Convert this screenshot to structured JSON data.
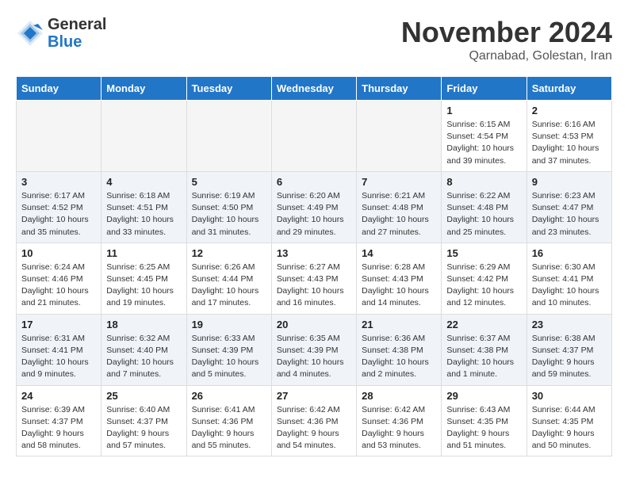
{
  "logo": {
    "general": "General",
    "blue": "Blue"
  },
  "title": "November 2024",
  "subtitle": "Qarnabad, Golestan, Iran",
  "weekdays": [
    "Sunday",
    "Monday",
    "Tuesday",
    "Wednesday",
    "Thursday",
    "Friday",
    "Saturday"
  ],
  "weeks": [
    [
      {
        "day": "",
        "info": ""
      },
      {
        "day": "",
        "info": ""
      },
      {
        "day": "",
        "info": ""
      },
      {
        "day": "",
        "info": ""
      },
      {
        "day": "",
        "info": ""
      },
      {
        "day": "1",
        "info": "Sunrise: 6:15 AM\nSunset: 4:54 PM\nDaylight: 10 hours\nand 39 minutes."
      },
      {
        "day": "2",
        "info": "Sunrise: 6:16 AM\nSunset: 4:53 PM\nDaylight: 10 hours\nand 37 minutes."
      }
    ],
    [
      {
        "day": "3",
        "info": "Sunrise: 6:17 AM\nSunset: 4:52 PM\nDaylight: 10 hours\nand 35 minutes."
      },
      {
        "day": "4",
        "info": "Sunrise: 6:18 AM\nSunset: 4:51 PM\nDaylight: 10 hours\nand 33 minutes."
      },
      {
        "day": "5",
        "info": "Sunrise: 6:19 AM\nSunset: 4:50 PM\nDaylight: 10 hours\nand 31 minutes."
      },
      {
        "day": "6",
        "info": "Sunrise: 6:20 AM\nSunset: 4:49 PM\nDaylight: 10 hours\nand 29 minutes."
      },
      {
        "day": "7",
        "info": "Sunrise: 6:21 AM\nSunset: 4:48 PM\nDaylight: 10 hours\nand 27 minutes."
      },
      {
        "day": "8",
        "info": "Sunrise: 6:22 AM\nSunset: 4:48 PM\nDaylight: 10 hours\nand 25 minutes."
      },
      {
        "day": "9",
        "info": "Sunrise: 6:23 AM\nSunset: 4:47 PM\nDaylight: 10 hours\nand 23 minutes."
      }
    ],
    [
      {
        "day": "10",
        "info": "Sunrise: 6:24 AM\nSunset: 4:46 PM\nDaylight: 10 hours\nand 21 minutes."
      },
      {
        "day": "11",
        "info": "Sunrise: 6:25 AM\nSunset: 4:45 PM\nDaylight: 10 hours\nand 19 minutes."
      },
      {
        "day": "12",
        "info": "Sunrise: 6:26 AM\nSunset: 4:44 PM\nDaylight: 10 hours\nand 17 minutes."
      },
      {
        "day": "13",
        "info": "Sunrise: 6:27 AM\nSunset: 4:43 PM\nDaylight: 10 hours\nand 16 minutes."
      },
      {
        "day": "14",
        "info": "Sunrise: 6:28 AM\nSunset: 4:43 PM\nDaylight: 10 hours\nand 14 minutes."
      },
      {
        "day": "15",
        "info": "Sunrise: 6:29 AM\nSunset: 4:42 PM\nDaylight: 10 hours\nand 12 minutes."
      },
      {
        "day": "16",
        "info": "Sunrise: 6:30 AM\nSunset: 4:41 PM\nDaylight: 10 hours\nand 10 minutes."
      }
    ],
    [
      {
        "day": "17",
        "info": "Sunrise: 6:31 AM\nSunset: 4:41 PM\nDaylight: 10 hours\nand 9 minutes."
      },
      {
        "day": "18",
        "info": "Sunrise: 6:32 AM\nSunset: 4:40 PM\nDaylight: 10 hours\nand 7 minutes."
      },
      {
        "day": "19",
        "info": "Sunrise: 6:33 AM\nSunset: 4:39 PM\nDaylight: 10 hours\nand 5 minutes."
      },
      {
        "day": "20",
        "info": "Sunrise: 6:35 AM\nSunset: 4:39 PM\nDaylight: 10 hours\nand 4 minutes."
      },
      {
        "day": "21",
        "info": "Sunrise: 6:36 AM\nSunset: 4:38 PM\nDaylight: 10 hours\nand 2 minutes."
      },
      {
        "day": "22",
        "info": "Sunrise: 6:37 AM\nSunset: 4:38 PM\nDaylight: 10 hours\nand 1 minute."
      },
      {
        "day": "23",
        "info": "Sunrise: 6:38 AM\nSunset: 4:37 PM\nDaylight: 9 hours\nand 59 minutes."
      }
    ],
    [
      {
        "day": "24",
        "info": "Sunrise: 6:39 AM\nSunset: 4:37 PM\nDaylight: 9 hours\nand 58 minutes."
      },
      {
        "day": "25",
        "info": "Sunrise: 6:40 AM\nSunset: 4:37 PM\nDaylight: 9 hours\nand 57 minutes."
      },
      {
        "day": "26",
        "info": "Sunrise: 6:41 AM\nSunset: 4:36 PM\nDaylight: 9 hours\nand 55 minutes."
      },
      {
        "day": "27",
        "info": "Sunrise: 6:42 AM\nSunset: 4:36 PM\nDaylight: 9 hours\nand 54 minutes."
      },
      {
        "day": "28",
        "info": "Sunrise: 6:42 AM\nSunset: 4:36 PM\nDaylight: 9 hours\nand 53 minutes."
      },
      {
        "day": "29",
        "info": "Sunrise: 6:43 AM\nSunset: 4:35 PM\nDaylight: 9 hours\nand 51 minutes."
      },
      {
        "day": "30",
        "info": "Sunrise: 6:44 AM\nSunset: 4:35 PM\nDaylight: 9 hours\nand 50 minutes."
      }
    ]
  ]
}
